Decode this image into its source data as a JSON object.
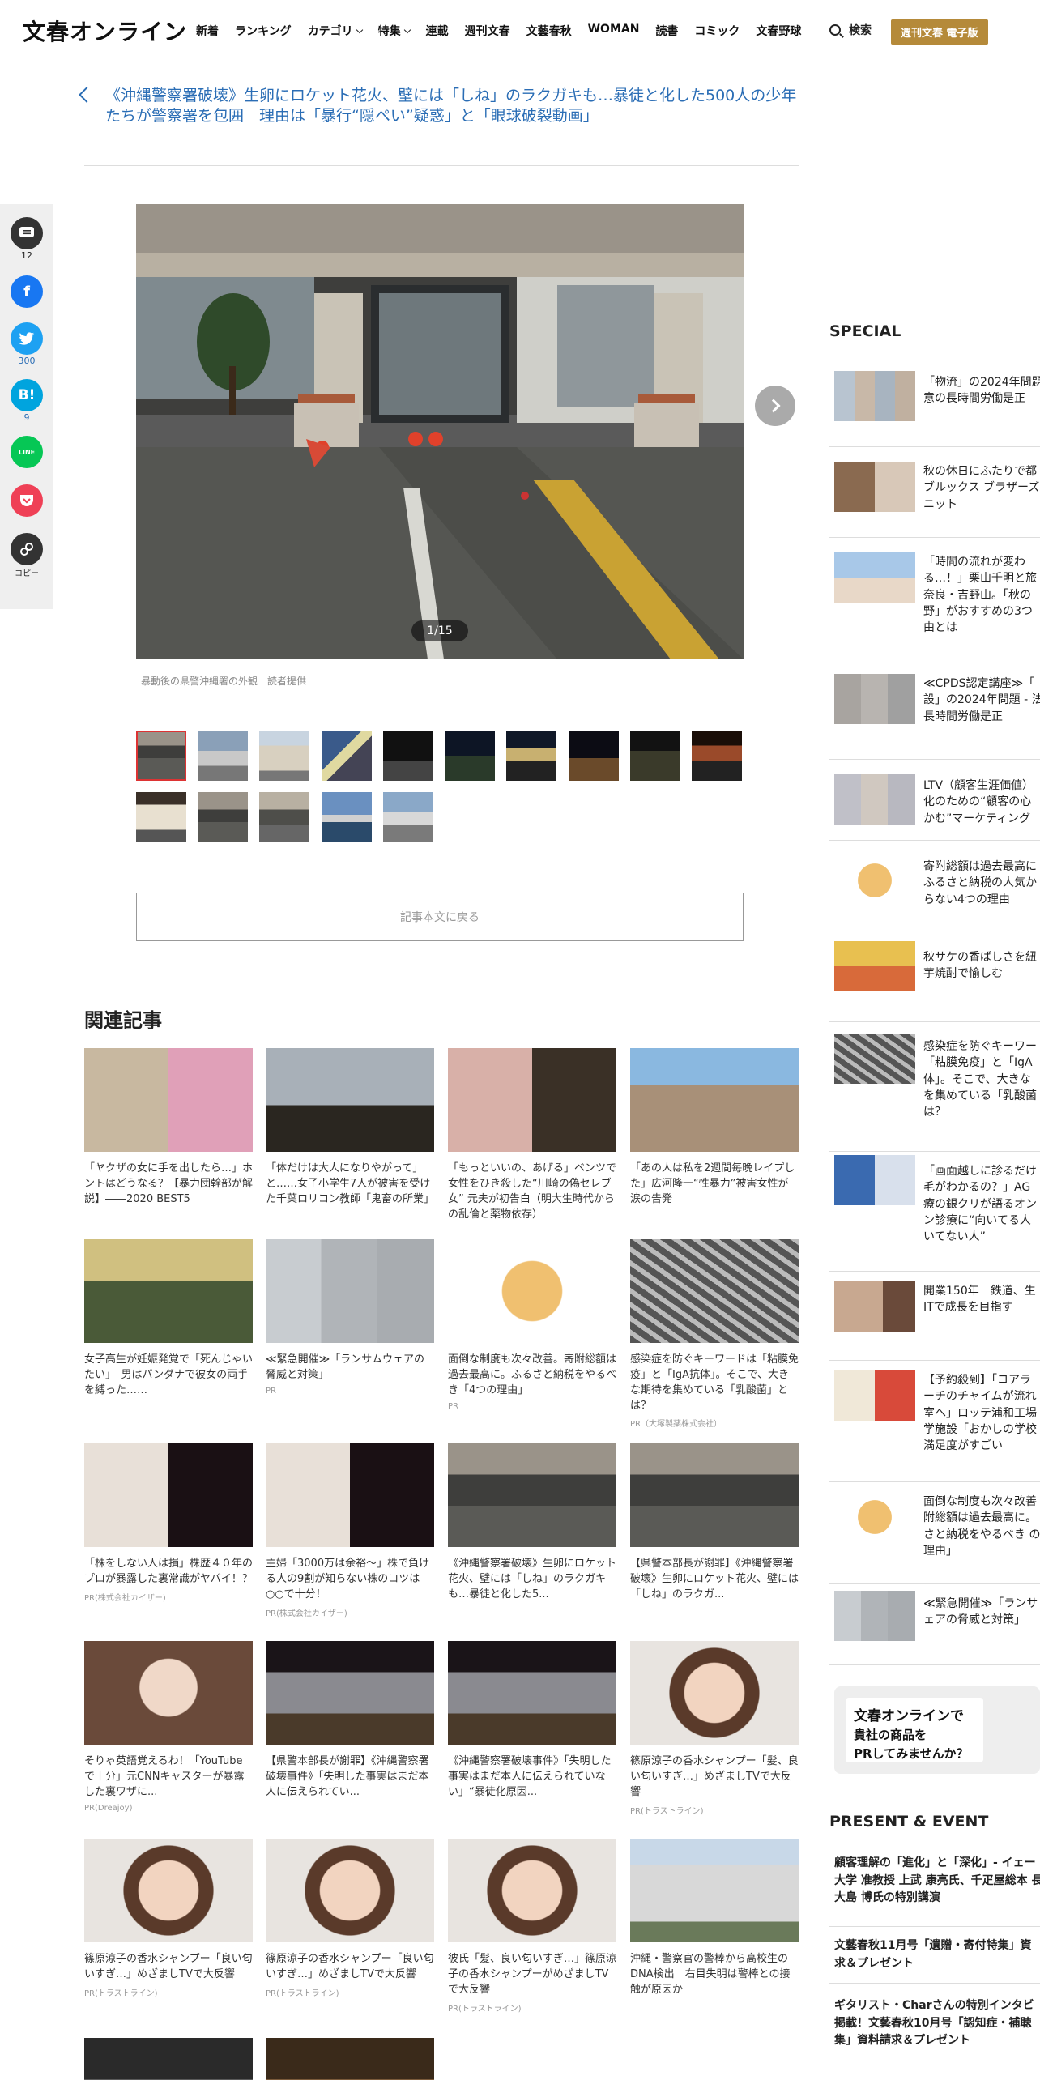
{
  "header": {
    "logo": "文春オンライン",
    "nav": [
      {
        "label": "新着",
        "dropdown": false
      },
      {
        "label": "ランキング",
        "dropdown": false
      },
      {
        "label": "カテゴリ",
        "dropdown": true
      },
      {
        "label": "特集",
        "dropdown": true
      },
      {
        "label": "連載",
        "dropdown": false
      },
      {
        "label": "週刊文春",
        "dropdown": false
      },
      {
        "label": "文藝春秋",
        "dropdown": false
      },
      {
        "label": "WOMAN",
        "dropdown": false
      },
      {
        "label": "読書",
        "dropdown": false
      },
      {
        "label": "コミック",
        "dropdown": false
      },
      {
        "label": "文春野球",
        "dropdown": false
      }
    ],
    "search_label": "検索",
    "ebook_label": "週刊文春 電子版"
  },
  "article": {
    "back_title": "《沖縄警察署破壊》生卵にロケット花火、壁には「しね」のラクガキも…暴徒と化した500人の少年たちが警察署を包囲　理由は「暴行“隠ぺい”疑惑」と「眼球破裂動画」"
  },
  "share": [
    {
      "name": "comment",
      "count": "12"
    },
    {
      "name": "facebook",
      "count": ""
    },
    {
      "name": "twitter",
      "count": "300"
    },
    {
      "name": "hatena",
      "count": "9"
    },
    {
      "name": "line",
      "count": ""
    },
    {
      "name": "pocket",
      "count": ""
    },
    {
      "name": "copy",
      "count": "コピー"
    }
  ],
  "gallery": {
    "counter": "1/15",
    "caption": "暴動後の県警沖縄署の外観　読者提供",
    "return_label": "記事本文に戻る"
  },
  "related": {
    "title": "関連記事",
    "cards": [
      {
        "text": "「ヤクザの女に手を出したら…」ホントはどうなる？【暴力団幹部が解説】――2020 BEST5",
        "pr": ""
      },
      {
        "text": "「体だけは大人になりやがって」と……女子小学生7人が被害を受けた千葉ロリコン教師「鬼畜の所業」",
        "pr": ""
      },
      {
        "text": "「もっといいの、あげる」ベンツで女性をひき殺した“川崎の偽セレブ女” 元夫が初告白（明大生時代からの乱倫と薬物依存）",
        "pr": ""
      },
      {
        "text": "「あの人は私を2週間毎晩レイプした」広河隆一“性暴力”被害女性が涙の告発",
        "pr": ""
      },
      {
        "text": "女子高生が妊娠発覚で「死んじゃいたい」　男はパンダナで彼女の両手を縛った……",
        "pr": ""
      },
      {
        "text": "≪緊急開催≫「ランサムウェアの脅威と対策」",
        "pr": "PR"
      },
      {
        "text": "面倒な制度も次々改善。寄附総額は過去最高に。ふるさと納税をやるべき「4つの理由」",
        "pr": "PR"
      },
      {
        "text": "感染症を防ぐキーワードは「粘膜免疫」と「IgA抗体」。そこで、大きな期待を集めている「乳酸菌」とは？",
        "pr": "PR（大塚製薬株式会社）"
      },
      {
        "text": "「株をしない人は損」株歴４０年のプロが暴露した裏常識がヤバイ！？",
        "pr": "PR(株式会社カイザー)"
      },
      {
        "text": "主婦「3000万は余裕～」株で負ける人の9割が知らない株のコツは○○で十分！",
        "pr": "PR(株式会社カイザー)"
      },
      {
        "text": "《沖縄警察署破壊》生卵にロケット花火、壁には「しね」のラクガキも…暴徒と化した5...",
        "pr": ""
      },
      {
        "text": "【県警本部長が謝罪】《沖縄警察署破壊》生卵にロケット花火、壁には「しね」のラクガ...",
        "pr": ""
      },
      {
        "text": "そりゃ英語覚えるわ！「YouTubeで十分」元CNNキャスターが暴露した裏ワザに...",
        "pr": "PR(Dreajoy)"
      },
      {
        "text": "【県警本部長が謝罪】《沖縄警察署破壊事件》「失明した事実はまだ本人に伝えられてい...",
        "pr": ""
      },
      {
        "text": "《沖縄警察署破壊事件》「失明した事実はまだ本人に伝えられていない」“暴徒化原因...",
        "pr": ""
      },
      {
        "text": "篠原涼子の香水シャンプー「髪、良い匂いすぎ…」めざましTVで大反響",
        "pr": "PR(トラストライン)"
      },
      {
        "text": "篠原涼子の香水シャンプー「良い匂いすぎ…」めざましTVで大反響",
        "pr": "PR(トラストライン)"
      },
      {
        "text": "篠原涼子の香水シャンプー「良い匂いすぎ…」めざましTVで大反響",
        "pr": "PR(トラストライン)"
      },
      {
        "text": "彼氏「髪、良い匂いすぎ…」篠原涼子の香水シャンプーがめざましTVで大反響",
        "pr": "PR(トラストライン)"
      },
      {
        "text": "沖縄・警察官の警棒から高校生のDNA検出　右目失明は警棒との接触が原因か",
        "pr": ""
      }
    ]
  },
  "special": {
    "title": "SPECIAL",
    "items": [
      "「物流」の2024年問題 意の長時間労働是正",
      "秋の休日にふたりで都 ブルックス ブラザーズ ニット",
      "「時間の流れが変わ る…！」栗山千明と旅 奈良・吉野山。「秋の 野」がおすすめの3つ 由とは",
      "≪CPDS認定講座≫「 設」の2024年問題 - 法 長時間労働是正",
      "LTV（顧客生涯価値） 化のための“顧客の心 かむ”マーケティング",
      "寄附総額は過去最高に ふるさと納税の人気か らない4つの理由",
      "秋サケの香ばしさを紐 芋焼酎で愉しむ",
      "感染症を防ぐキーワー 「粘膜免疫」と「IgA 体」。そこで、大きな を集めている「乳酸菌 は？",
      "「画面越しに診るだけ 毛がわかるの？」AG 療の銀クリが語るオン ン診療に“向いてる人 いてない人”",
      "開業150年　鉄道、生 ITで成長を目指す",
      "【予約殺到】「コアラ ーチのチャイムが流れ 室へ」ロッテ浦和工場 学施設「おかしの学校 満足度がすごい",
      "面倒な制度も次々改善 附総額は過去最高に。 さと納税をやるべき の理由」",
      "≪緊急開催≫「ランサ ェアの脅威と対策」"
    ]
  },
  "ad": {
    "line1": "文春オンラインで",
    "line2": "貴社の商品を",
    "line3": "PRしてみませんか？"
  },
  "present": {
    "title": "PRESENT & EVENT",
    "items": [
      "顧客理解の「進化」と「深化」- イェー 大学 准教授 上武 康亮氏、千疋屋総本 長 大島 博氏の特別講演",
      "文藝春秋11月号「遺贈・寄付特集」資 求＆プレゼント",
      "ギタリスト・Charさんの特別インタビ 掲載！文藝春秋10月号「認知症・補聴 集」資料請求＆プレゼント"
    ]
  },
  "colors": {
    "link_blue": "#2a6db5",
    "ebook_gold": "#b58a3a",
    "share_facebook": "#1877f2",
    "share_twitter": "#1da1f2",
    "share_hatena": "#00a4de",
    "share_line": "#06c755",
    "share_pocket": "#ef4056"
  }
}
